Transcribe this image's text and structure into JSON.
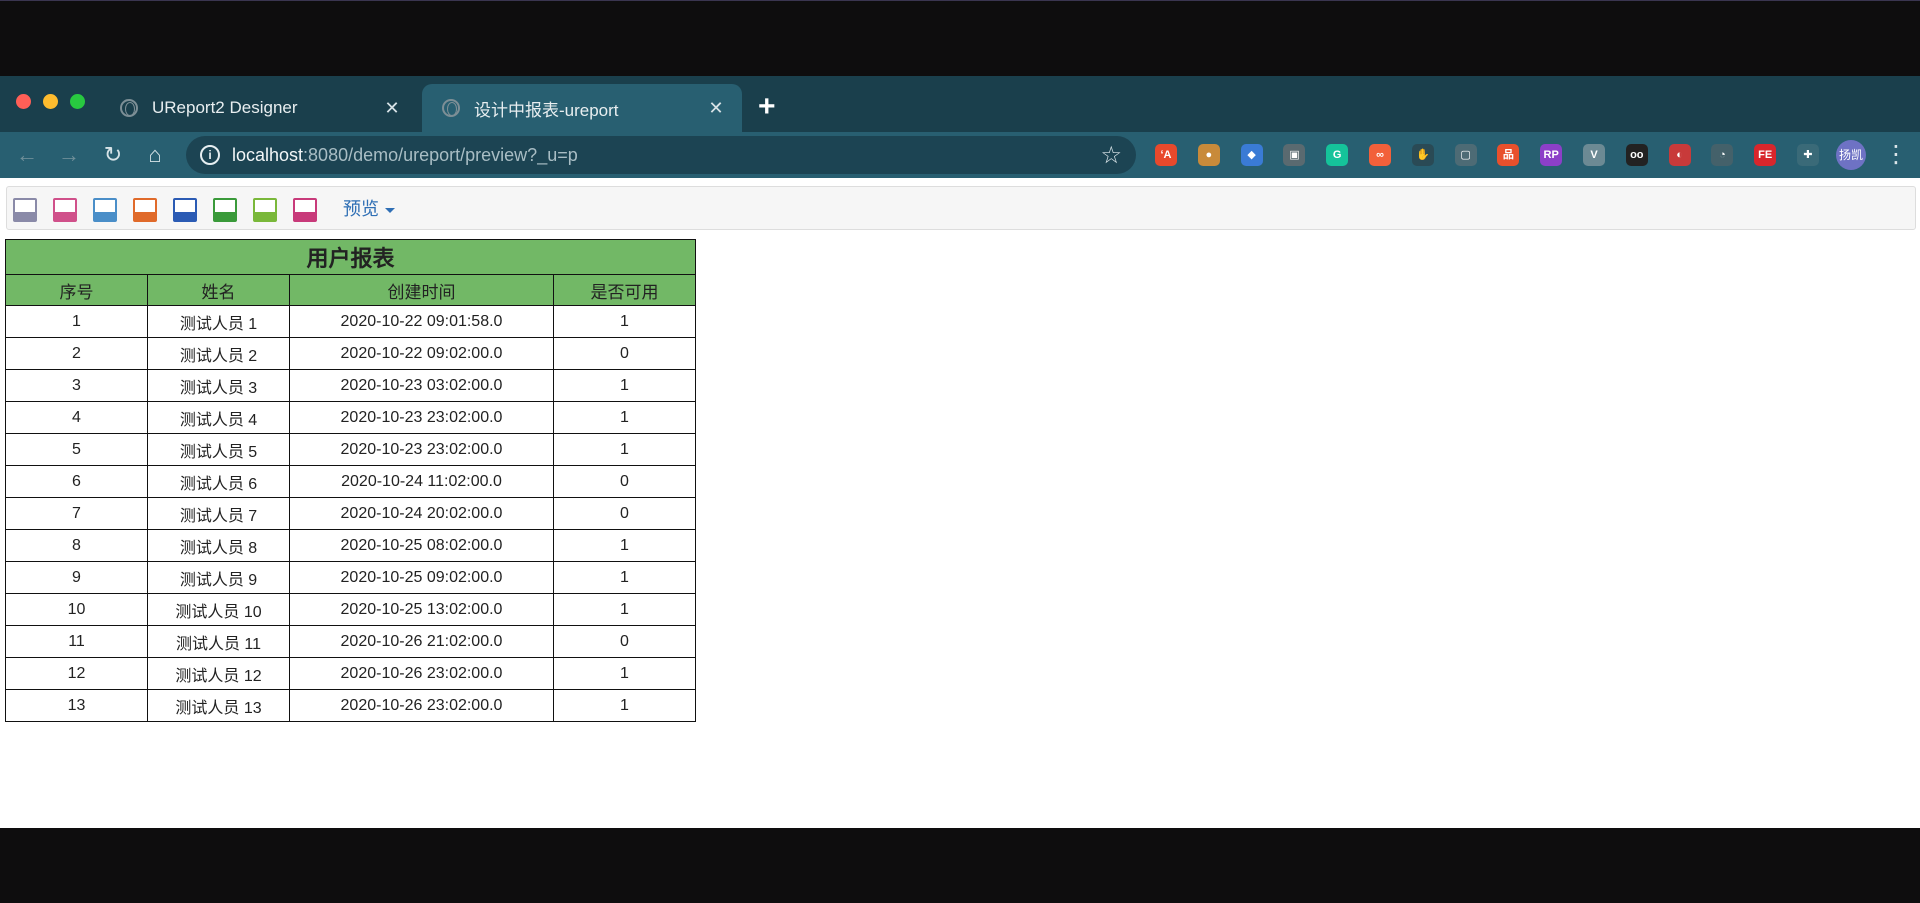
{
  "browser": {
    "tabs": [
      {
        "title": "UReport2 Designer",
        "close": "✕",
        "active": false
      },
      {
        "title": "设计中报表-ureport",
        "close": "✕",
        "active": true
      }
    ],
    "new_tab": "+",
    "url_host": "localhost",
    "url_rest": ":8080/demo/ureport/preview?_u=p",
    "avatar_text": "扬凯",
    "extensions": [
      {
        "name": "translate-ext-icon",
        "label": "ʻA",
        "color": "#e8492c"
      },
      {
        "name": "cookie-ext-icon",
        "label": "●",
        "color": "#c88a3a"
      },
      {
        "name": "gem-ext-icon",
        "label": "◆",
        "color": "#3a7bd5"
      },
      {
        "name": "camera-ext-icon",
        "label": "▣",
        "color": "#5a6a70"
      },
      {
        "name": "grammarly-ext-icon",
        "label": "G",
        "color": "#15c39a"
      },
      {
        "name": "infinity-ext-icon",
        "label": "∞",
        "color": "#f2603a"
      },
      {
        "name": "hand-ext-icon",
        "label": "✋",
        "color": "#2a4a55"
      },
      {
        "name": "box-ext-icon",
        "label": "▢",
        "color": "#4d6b75"
      },
      {
        "name": "sitemap-ext-icon",
        "label": "品",
        "color": "#e8502c"
      },
      {
        "name": "axure-rp-ext-icon",
        "label": "RP",
        "color": "#8c3fc8"
      },
      {
        "name": "vue-ext-icon",
        "label": "V",
        "color": "#6c8a94"
      },
      {
        "name": "glasses-ext-icon",
        "label": "oo",
        "color": "#222222"
      },
      {
        "name": "refresh-ext-icon",
        "label": "◐",
        "color": "#c83a3a"
      },
      {
        "name": "ghost-ext-icon",
        "label": "◔",
        "color": "#44616a"
      },
      {
        "name": "fe-ext-icon",
        "label": "FE",
        "color": "#d8262c"
      },
      {
        "name": "puzzle-ext-icon",
        "label": "✚",
        "color": "#3a6a78"
      }
    ]
  },
  "report_toolbar": {
    "icons": [
      {
        "name": "print-preview-icon",
        "color": "#8a8aa8"
      },
      {
        "name": "print-pdf-icon",
        "color": "#d0508a"
      },
      {
        "name": "print-icon",
        "color": "#4a8ec8"
      },
      {
        "name": "export-pdf-icon",
        "color": "#e06a2a"
      },
      {
        "name": "export-word-icon",
        "color": "#2b5bb4"
      },
      {
        "name": "export-excel-icon",
        "color": "#3a9a3a"
      },
      {
        "name": "export-excel-paged-icon",
        "color": "#7ab83a"
      },
      {
        "name": "export-excel-sheet-icon",
        "color": "#c83a7a"
      }
    ],
    "preview_label": "预览"
  },
  "report": {
    "title": "用户报表",
    "headers": [
      "序号",
      "姓名",
      "创建时间",
      "是否可用"
    ],
    "rows": [
      [
        "1",
        "测试人员 1",
        "2020-10-22 09:01:58.0",
        "1"
      ],
      [
        "2",
        "测试人员 2",
        "2020-10-22 09:02:00.0",
        "0"
      ],
      [
        "3",
        "测试人员 3",
        "2020-10-23 03:02:00.0",
        "1"
      ],
      [
        "4",
        "测试人员 4",
        "2020-10-23 23:02:00.0",
        "1"
      ],
      [
        "5",
        "测试人员 5",
        "2020-10-23 23:02:00.0",
        "1"
      ],
      [
        "6",
        "测试人员 6",
        "2020-10-24 11:02:00.0",
        "0"
      ],
      [
        "7",
        "测试人员 7",
        "2020-10-24 20:02:00.0",
        "0"
      ],
      [
        "8",
        "测试人员 8",
        "2020-10-25 08:02:00.0",
        "1"
      ],
      [
        "9",
        "测试人员 9",
        "2020-10-25 09:02:00.0",
        "1"
      ],
      [
        "10",
        "测试人员 10",
        "2020-10-25 13:02:00.0",
        "1"
      ],
      [
        "11",
        "测试人员 11",
        "2020-10-26 21:02:00.0",
        "0"
      ],
      [
        "12",
        "测试人员 12",
        "2020-10-26 23:02:00.0",
        "1"
      ],
      [
        "13",
        "测试人员 13",
        "2020-10-26 23:02:00.0",
        "1"
      ]
    ]
  }
}
